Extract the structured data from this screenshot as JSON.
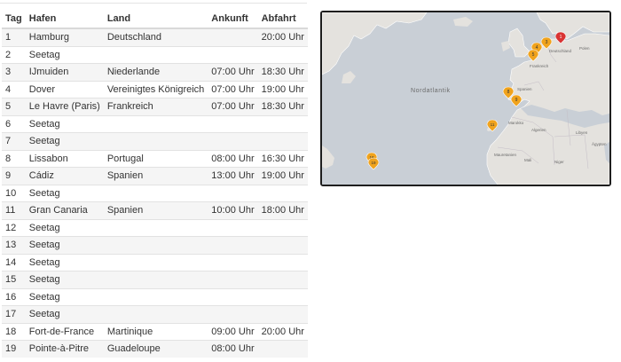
{
  "table": {
    "headers": {
      "tag": "Tag",
      "hafen": "Hafen",
      "land": "Land",
      "ankunft": "Ankunft",
      "abfahrt": "Abfahrt"
    },
    "rows": [
      {
        "tag": "1",
        "hafen": "Hamburg",
        "land": "Deutschland",
        "ankunft": "",
        "abfahrt": "20:00 Uhr"
      },
      {
        "tag": "2",
        "hafen": "Seetag",
        "land": "",
        "ankunft": "",
        "abfahrt": ""
      },
      {
        "tag": "3",
        "hafen": "IJmuiden",
        "land": "Niederlande",
        "ankunft": "07:00 Uhr",
        "abfahrt": "18:30 Uhr"
      },
      {
        "tag": "4",
        "hafen": "Dover",
        "land": "Vereinigtes Königreich",
        "ankunft": "07:00 Uhr",
        "abfahrt": "19:00 Uhr"
      },
      {
        "tag": "5",
        "hafen": "Le Havre (Paris)",
        "land": "Frankreich",
        "ankunft": "07:00 Uhr",
        "abfahrt": "18:30 Uhr"
      },
      {
        "tag": "6",
        "hafen": "Seetag",
        "land": "",
        "ankunft": "",
        "abfahrt": ""
      },
      {
        "tag": "7",
        "hafen": "Seetag",
        "land": "",
        "ankunft": "",
        "abfahrt": ""
      },
      {
        "tag": "8",
        "hafen": "Lissabon",
        "land": "Portugal",
        "ankunft": "08:00 Uhr",
        "abfahrt": "16:30 Uhr"
      },
      {
        "tag": "9",
        "hafen": "Cádiz",
        "land": "Spanien",
        "ankunft": "13:00 Uhr",
        "abfahrt": "19:00 Uhr"
      },
      {
        "tag": "10",
        "hafen": "Seetag",
        "land": "",
        "ankunft": "",
        "abfahrt": ""
      },
      {
        "tag": "11",
        "hafen": "Gran Canaria",
        "land": "Spanien",
        "ankunft": "10:00 Uhr",
        "abfahrt": "18:00 Uhr"
      },
      {
        "tag": "12",
        "hafen": "Seetag",
        "land": "",
        "ankunft": "",
        "abfahrt": ""
      },
      {
        "tag": "13",
        "hafen": "Seetag",
        "land": "",
        "ankunft": "",
        "abfahrt": ""
      },
      {
        "tag": "14",
        "hafen": "Seetag",
        "land": "",
        "ankunft": "",
        "abfahrt": ""
      },
      {
        "tag": "15",
        "hafen": "Seetag",
        "land": "",
        "ankunft": "",
        "abfahrt": ""
      },
      {
        "tag": "16",
        "hafen": "Seetag",
        "land": "",
        "ankunft": "",
        "abfahrt": ""
      },
      {
        "tag": "17",
        "hafen": "Seetag",
        "land": "",
        "ankunft": "",
        "abfahrt": ""
      },
      {
        "tag": "18",
        "hafen": "Fort-de-France",
        "land": "Martinique",
        "ankunft": "09:00 Uhr",
        "abfahrt": "20:00 Uhr"
      },
      {
        "tag": "19",
        "hafen": "Pointe-à-Pitre",
        "land": "Guadeloupe",
        "ankunft": "08:00 Uhr",
        "abfahrt": ""
      }
    ]
  },
  "map": {
    "ocean_label": "Nordatlantik",
    "place_labels": [
      "Deutschland",
      "Polen",
      "Frankreich",
      "Spanien",
      "Marokko",
      "Algerien",
      "Libyen",
      "Ägypten",
      "Mauretanien",
      "Mali",
      "Niger"
    ],
    "markers": [
      "1",
      "3",
      "4",
      "5",
      "8",
      "9",
      "11",
      "18",
      "19"
    ],
    "colors": {
      "ocean": "#c9cfd6",
      "land": "#e4e2de",
      "marker_start": "#d93434",
      "marker": "#f0a31d"
    },
    "icons": {
      "start": "map-pin-icon",
      "port": "map-pin-icon"
    }
  }
}
